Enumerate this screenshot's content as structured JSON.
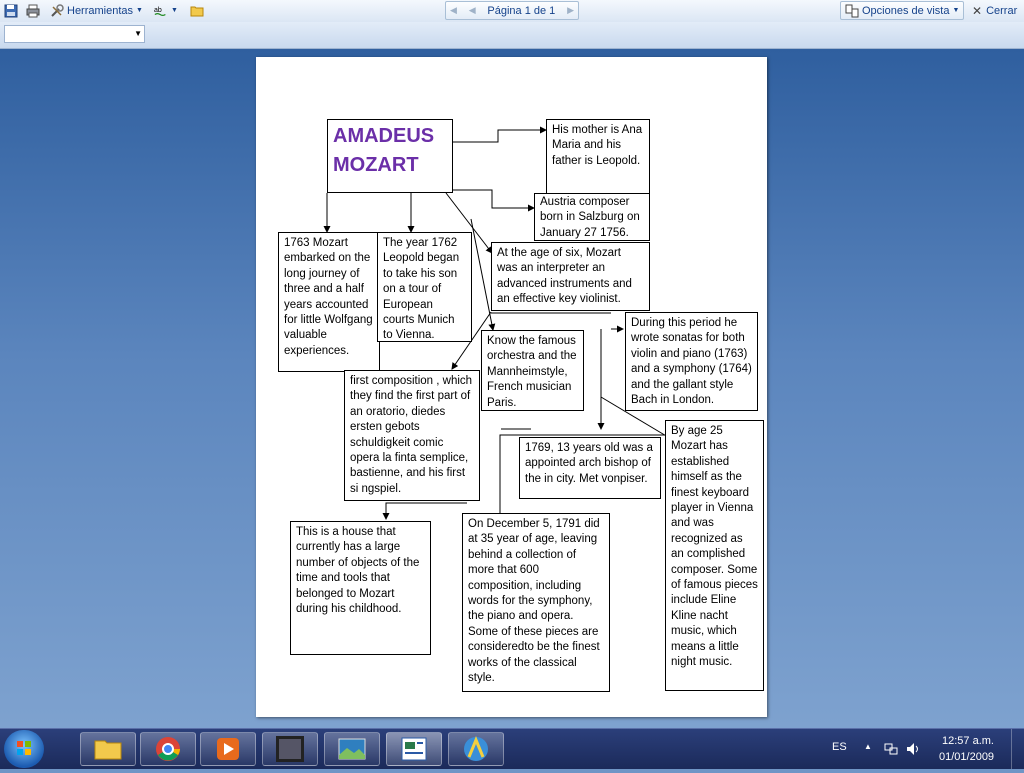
{
  "toolbar": {
    "tools_label": "Herramientas",
    "page_indicator": "Página 1 de 1",
    "view_options_label": "Opciones de vista",
    "close_label": "Cerrar"
  },
  "document": {
    "title": "AMADEUS MOZART",
    "boxes": {
      "mother": "His mother is Ana Maria and his father is Leopold.",
      "born": "Austria composer born in Salzburg on January 27 1756.",
      "journey": "1763 Mozart embarked on the long journey of three and a half years accounted for little Wolfgang valuable experiences.",
      "tour": "The year 1762 Leopold began to take his son on a tour of European courts Munich to Vienna.",
      "age_six": "At the age of six, Mozart was an interpreter an advanced instruments and an effective key violinist.",
      "sonatas": "During this period he wrote sonatas for both violin and piano (1763) and a symphony (1764) and the gallant style Bach in London.",
      "orchestra": "Know the famous orchestra and the Mannheimstyle, French musician Paris.",
      "composition": "first composition , which they  find  the first part of an oratorio, diedes  ersten gebots schuldigkeit comic opera  la finta semplice, bastienne, and his first si ngspiel.",
      "archbishop": "1769, 13 years old was a appointed arch bishop of the in city. Met vonpiser.",
      "age25": "By age 25 Mozart has established himself as the finest keyboard player in Vienna and was recognized as an complished composer. Some of famous pieces include Eline Kline nacht music, which means a little night music.",
      "house": "This is a house that currently has a large number of objects of the time and tools that belonged to Mozart during  his childhood.",
      "death": "On December 5, 1791 did at 35 year of age, leaving behind a collection of more that 600 composition, including words for the symphony, the piano and opera. Some of these pieces are consideredto be the finest works of the classical style."
    }
  },
  "taskbar": {
    "language": "ES",
    "time": "12:57 a.m.",
    "date": "01/01/2009"
  },
  "colors": {
    "title": "#6b2fa8",
    "toolbar_text": "#15428b"
  }
}
